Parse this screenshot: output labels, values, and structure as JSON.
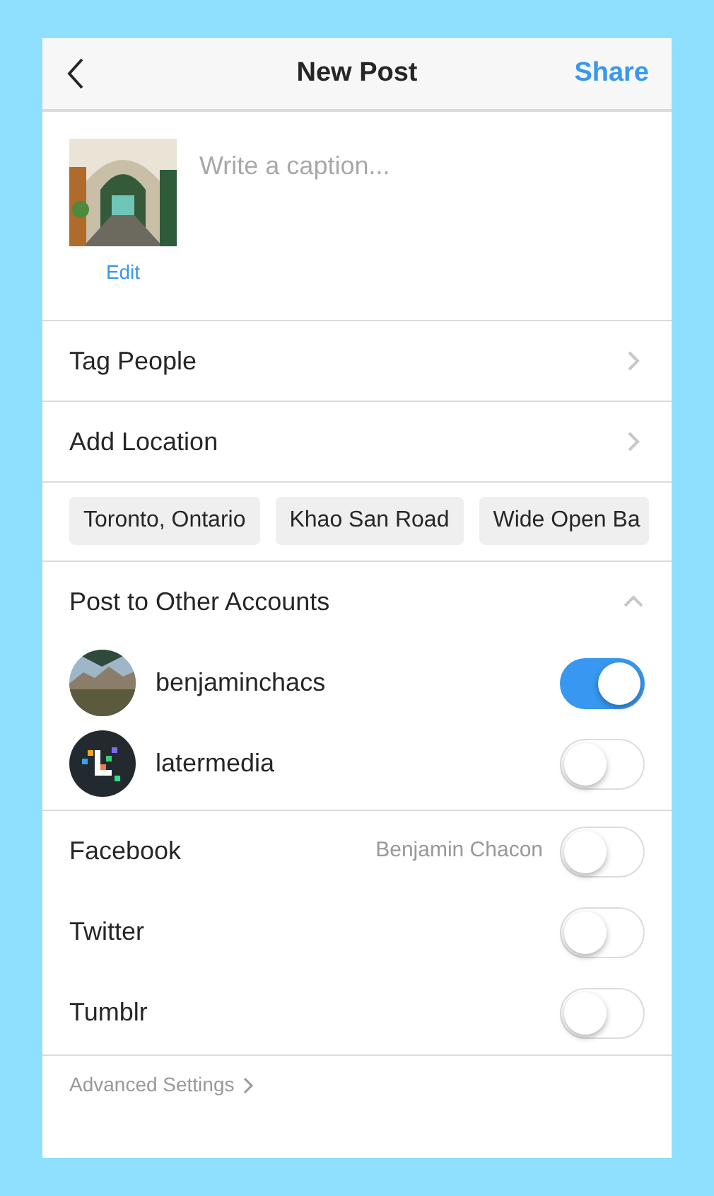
{
  "header": {
    "title": "New Post",
    "action": "Share"
  },
  "caption": {
    "placeholder": "Write a caption...",
    "edit": "Edit"
  },
  "links": [
    {
      "label": "Tag People"
    },
    {
      "label": "Add Location"
    }
  ],
  "locations": [
    "Toronto, Ontario",
    "Khao San Road",
    "Wide Open Ba"
  ],
  "other_accounts": {
    "title": "Post to Other Accounts",
    "expanded": true,
    "accounts": [
      {
        "name": "benjaminchacs",
        "kind": "picture",
        "on": true
      },
      {
        "name": "latermedia",
        "kind": "logo",
        "on": false
      }
    ]
  },
  "services": [
    {
      "name": "Facebook",
      "account": "Benjamin Chacon",
      "on": false
    },
    {
      "name": "Twitter",
      "on": false
    },
    {
      "name": "Tumblr",
      "on": false
    }
  ],
  "advanced": "Advanced Settings"
}
